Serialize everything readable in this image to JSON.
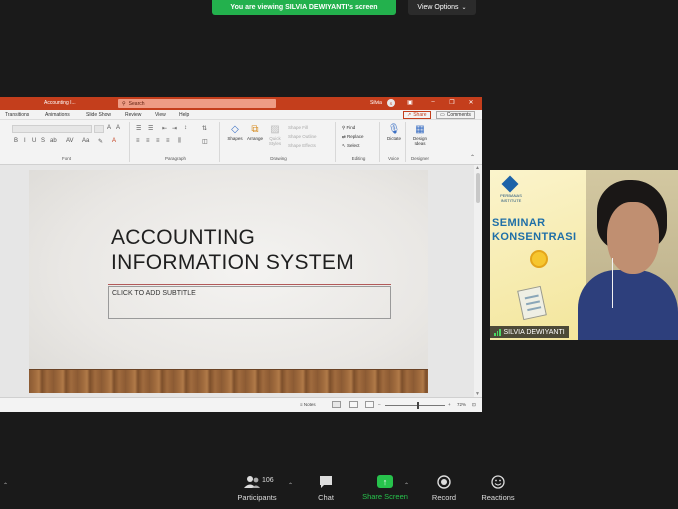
{
  "zoom": {
    "banner_text": "You are viewing SILVIA DEWIYANTI's screen",
    "view_options_label": "View Options",
    "toolbar": {
      "participants_label": "Participants",
      "participants_count": "106",
      "chat_label": "Chat",
      "share_screen_label": "Share Screen",
      "record_label": "Record",
      "reactions_label": "Reactions"
    },
    "video": {
      "participant_name": "SILVIA DEWIYANTI",
      "poster_logo_text": "PERBANAS INSTITUTE",
      "poster_title_line1": "SEMINAR",
      "poster_title_line2": "KONSENTRASI"
    }
  },
  "ppt": {
    "document_title": "Accounting I...",
    "search_placeholder": "Search",
    "user_name": "Silvia",
    "tabs": [
      "Transitions",
      "Animations",
      "Slide Show",
      "Review",
      "View",
      "Help"
    ],
    "share_label": "Share",
    "comments_label": "Comments",
    "ribbon_groups": {
      "font": "Font",
      "paragraph": "Paragraph",
      "drawing": "Drawing",
      "editing": "Editing",
      "voice": "Voice",
      "designer": "Designer"
    },
    "ribbon_buttons": {
      "shapes": "Shapes",
      "arrange": "Arrange",
      "quick_styles": "Quick Styles",
      "shape_fill": "Shape Fill",
      "shape_outline": "Shape Outline",
      "shape_effects": "Shape Effects",
      "find": "Find",
      "replace": "Replace",
      "select": "Select",
      "dictate": "Dictate",
      "design_ideas": "Design Ideas"
    },
    "slide": {
      "title_line1": "ACCOUNTING",
      "title_line2": "INFORMATION SYSTEM",
      "subtitle_placeholder": "CLICK TO ADD SUBTITLE"
    },
    "status": {
      "notes_label": "Notes",
      "zoom_level": "72%"
    }
  }
}
